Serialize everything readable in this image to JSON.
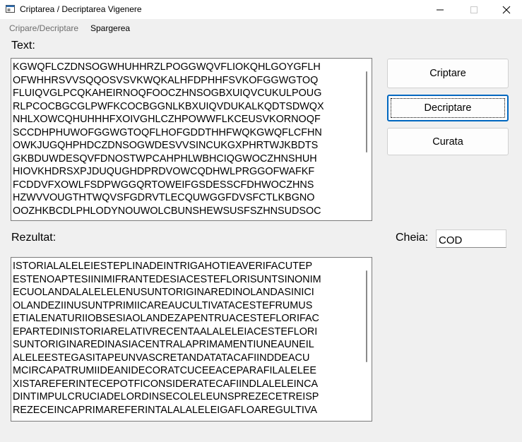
{
  "window": {
    "title": "Criptarea / Decriptarea Vigenere"
  },
  "menu": {
    "items": [
      "Cripare/Decriptare",
      "Spargerea"
    ]
  },
  "labels": {
    "text": "Text:",
    "result": "Rezultat:",
    "key": "Cheia:"
  },
  "input_text": {
    "lines": [
      "KGWQFLCZDNSOGWHUHHRZLPOGGWQVFLIOKQHLGOYGFLH",
      "OFWHHRSVVSQQOSVSVKWQKALHFDPHHFSVKOFGGWGTOQ",
      "FLUIQVGLPCQKAHEIRNOQFOOCZHNSOGBXUIQVCUKULPOUG",
      "RLPCOCBGCGLPWFKCOCBGGNLKBXUIQVDUKALKQDTSDWQX",
      "NHLXOWCQHUHHHFXOIVGHLCZHPOWWFLKCEUSVKORNOQF",
      "SCCDHPHUWOFGGWGTOQFLHOFGDDTHHFWQKGWQFLCFHN",
      "OWKJUGQHPHDCZDNSOGWDESVVSINCUKGXPHRTWJKBDTS",
      "GKBDUWDESQVFDNOSTWPCAHPHLWBHCIQGWOCZHNSHUH",
      "HIOVKHDRSXPJDUQUGHDPRDVOWCQDHWLPRGGOFWAFKF",
      "FCDDVFXOWLFSDPWGGQRTOWEIFGSDESSCFDHWOCZHNS",
      "HZWVVOUGTHTWQVSFGDRVTLECQUWGGFDVSFCTLKBGNO",
      "OOZHKBCDLPHLODYNOUWOLCBUNSHEWSUSFSZHNSUDSOC"
    ]
  },
  "result_text": {
    "lines": [
      "ISTORIALALELEIESTEPLINADEINTRIGAHOTIEAVERIFACUTEP",
      "ESTENOAPTESIINIMIFRANTEDESIACESTEFLORISUNTSINONIM",
      "ECUOLANDALALELELENUSUNTORIGINAREDINOLANDASINICI",
      "OLANDEZIINUSUNTPRIMIICAREAUCULTIVATACESTEFRUMUS",
      "ETIALENATURIIOBSESIAOLANDEZAPENTRUACESTEFLORIFAC",
      "EPARTEDINISTORIARELATIVRECENTAALALELEIACESTEFLORI",
      "SUNTORIGINAREDINASIACENTRALAPRIMAMENTIUNEAUNEIL",
      "ALELEESTEGASITAPEUNVASCRETANDATATACAFIINDDEACU",
      "MCIRCAPATRUMIIDEANIDECORATCUCEEACEPARAFILALELEE",
      "XISTAREFERINTECEPOTFICONSIDERATECAFIINDLALELEINCA",
      "DINTIMPULCRUCIADELORDINSECOLELEUNSPREZECETREISP",
      "REZECEINCAPRIMAREFERINTALALALELEIGAFLOAREGULTIVA"
    ]
  },
  "buttons": {
    "encrypt": "Criptare",
    "decrypt": "Decriptare",
    "clear": "Curata"
  },
  "key": {
    "value": "COD"
  },
  "colors": {
    "window_bg": "#f0f0f0",
    "focus_border": "#0067c0"
  }
}
